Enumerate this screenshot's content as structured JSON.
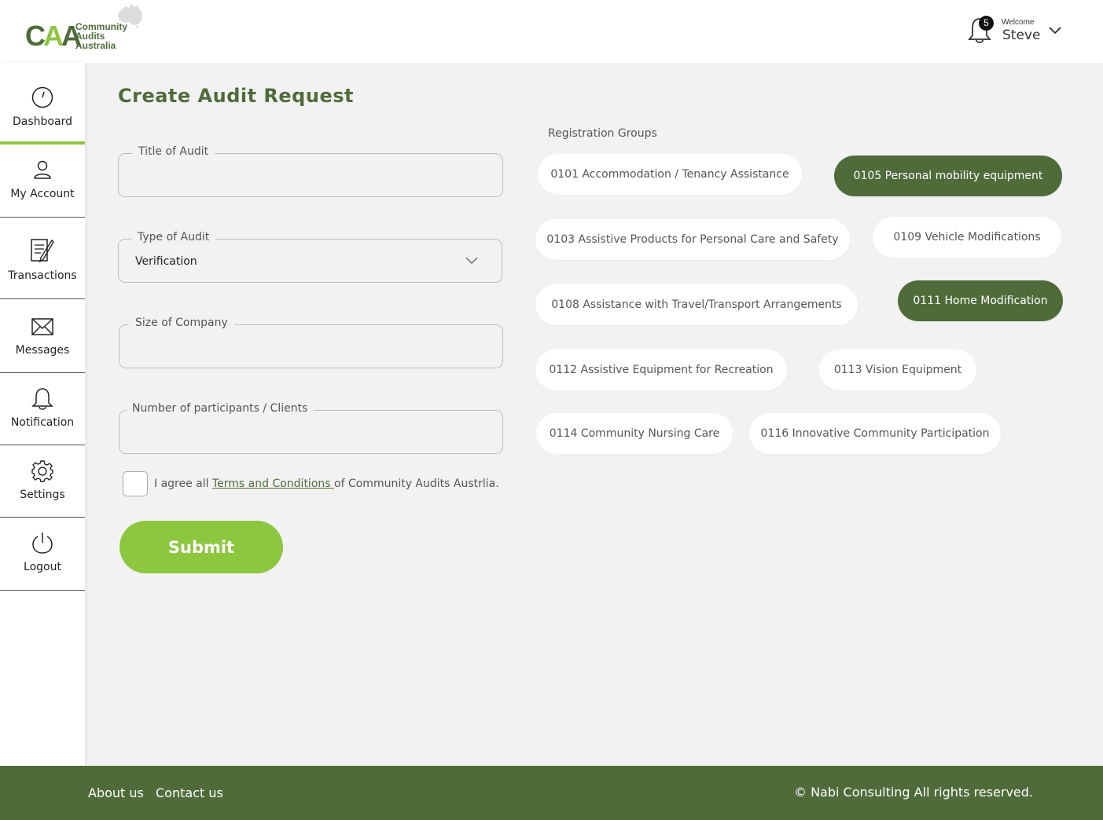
{
  "brand": {
    "logo_text_line1": "Community",
    "logo_text_line2": "Audits",
    "logo_text_line3": "Australia",
    "primary_color": "#4f6b3a",
    "accent_color": "#8dc63f"
  },
  "header": {
    "notification_count": "5",
    "welcome_label": "Welcome",
    "username": "Steve"
  },
  "sidebar": {
    "items": [
      {
        "label": "Dashboard",
        "icon": "dashboard-icon",
        "active": true
      },
      {
        "label": "My Account",
        "icon": "user-icon"
      },
      {
        "label": "Transactions",
        "icon": "transactions-icon"
      },
      {
        "label": "Messages",
        "icon": "envelope-icon"
      },
      {
        "label": "Notification",
        "icon": "bell-icon"
      },
      {
        "label": "Settings",
        "icon": "gear-icon"
      },
      {
        "label": "Logout",
        "icon": "power-icon"
      }
    ]
  },
  "form": {
    "title": "Create Audit Request",
    "title_of_audit_label": "Title of Audit",
    "title_of_audit_value": "",
    "type_of_audit_label": "Type of Audit",
    "type_of_audit_value": "Verification",
    "size_of_company_label": "Size of Company",
    "size_of_company_value": "",
    "participants_label": "Number of participants / Clients",
    "participants_value": "",
    "agree_prefix": "I agree all ",
    "agree_link": "Terms and Conditions ",
    "agree_suffix": "of Community Audits Austrlia.",
    "submit_label": "Submit"
  },
  "registration_groups": {
    "title": "Registration Groups",
    "items": [
      {
        "label": "0101 Accommodation / Tenancy Assistance",
        "selected": false
      },
      {
        "label": "0105 Personal mobility equipment",
        "selected": true
      },
      {
        "label": "0103 Assistive Products for Personal Care and Safety",
        "selected": false
      },
      {
        "label": "0109 Vehicle Modifications",
        "selected": false
      },
      {
        "label": "0108 Assistance with Travel/Transport Arrangements",
        "selected": false
      },
      {
        "label": "0111 Home Modification",
        "selected": true
      },
      {
        "label": "0112 Assistive Equipment for Recreation",
        "selected": false
      },
      {
        "label": "0113 Vision Equipment",
        "selected": false
      },
      {
        "label": "0114 Community Nursing Care",
        "selected": false
      },
      {
        "label": "0116 Innovative Community Participation",
        "selected": false
      }
    ]
  },
  "footer": {
    "about_label": "About us",
    "contact_label": "Contact us",
    "copyright": "© Nabi Consulting All rights reserved."
  }
}
